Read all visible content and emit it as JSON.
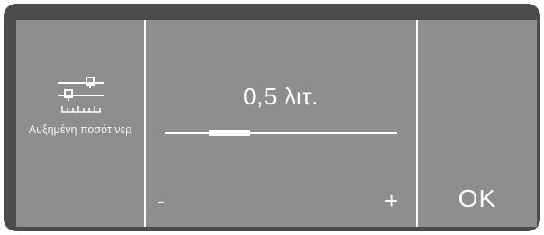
{
  "settings": {
    "label": "Αυξημένη ποσότ νερ",
    "icon": "water-amount-slider-icon"
  },
  "value_display": "0,5 λιτ.",
  "slider": {
    "level": 0.28,
    "decrease_label": "-",
    "increase_label": "+"
  },
  "actions": {
    "ok_label": "OK"
  },
  "colors": {
    "bezel": "#4b4b4b",
    "screen": "#8e8e8e",
    "foreground": "#ffffff"
  }
}
